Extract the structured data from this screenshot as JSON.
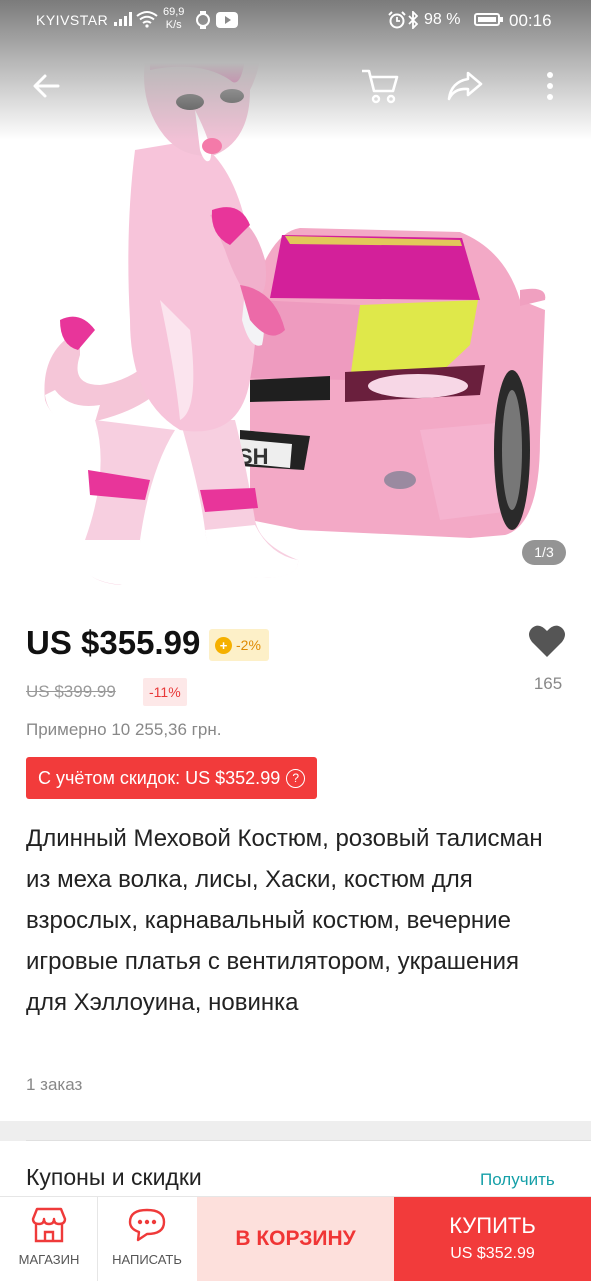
{
  "status_bar": {
    "carrier": "KYIVSTAR",
    "net_speed_value": "69,9",
    "net_speed_unit": "K/s",
    "battery": "98 %",
    "time": "00:16"
  },
  "toolbar": {
    "back_icon": "arrow-left-icon",
    "cart_icon": "cart-icon",
    "share_icon": "share-icon",
    "more_icon": "more-vertical-icon"
  },
  "gallery": {
    "page_indicator": "1/3"
  },
  "price": {
    "current": "US $355.99",
    "coin_discount": "-2%",
    "original": "US $399.99",
    "discount": "-11%",
    "approx_local": "Примерно 10 255,36 грн.",
    "with_discounts": "С учётом скидок: US $352.99",
    "help_icon": "?"
  },
  "wishlist": {
    "count": "165"
  },
  "product": {
    "title": "Длинный Меховой Костюм, розовый талисман из меха волка, лисы, Хаски, костюм для взрослых, карнавальный костюм, вечерние игровые платья с вентилятором, украшения для Хэллоуина, новинка",
    "orders": "1 заказ"
  },
  "coupons": {
    "label": "Купоны и скидки",
    "action": "Получить"
  },
  "bottom_bar": {
    "store_label": "МАГАЗИН",
    "message_label": "НАПИСАТЬ",
    "add_to_cart": "В КОРЗИНУ",
    "buy_label": "КУПИТЬ",
    "buy_price": "US $352.99"
  },
  "colors": {
    "accent_red": "#f23b3b",
    "cart_bg": "#fde0dc",
    "link_teal": "#16a0a8",
    "coin_gold": "#f5b000"
  }
}
